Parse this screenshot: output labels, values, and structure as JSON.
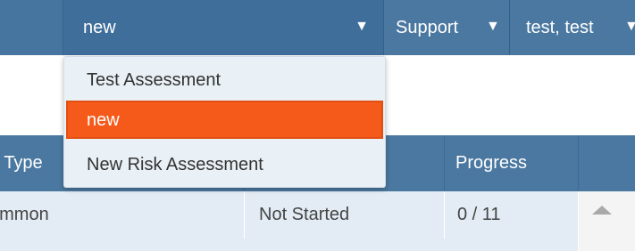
{
  "nav": {
    "assessment_select": {
      "value": "new",
      "caret": "▼"
    },
    "support": {
      "label": "Support",
      "caret": "▼"
    },
    "user": {
      "label": "test, test",
      "caret": "▼"
    }
  },
  "dropdown": {
    "items": [
      {
        "label": "Test Assessment",
        "selected": false
      },
      {
        "label": "new",
        "selected": true
      },
      {
        "label": "New Risk Assessment",
        "selected": false
      }
    ]
  },
  "table": {
    "headers": [
      "b Type",
      "",
      "Progress",
      ""
    ],
    "rows": [
      {
        "type": "ommon",
        "status": "Not Started",
        "progress": "0 / 11"
      }
    ]
  },
  "colors": {
    "nav_bg": "#4a78a0",
    "highlight": "#f55a1a",
    "row_bg": "#e3ecf4"
  },
  "icons": {
    "caret": "caret-down-icon",
    "scroll_up": "scroll-up-arrow-icon"
  }
}
